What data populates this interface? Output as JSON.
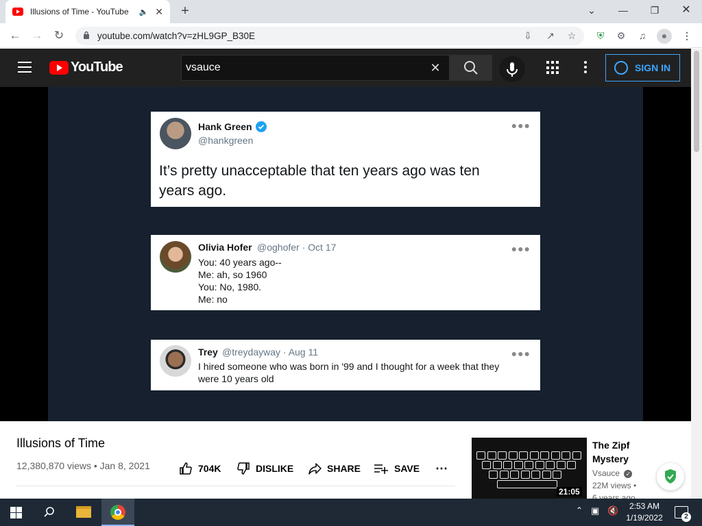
{
  "browser": {
    "tab_title": "Illusions of Time - YouTube",
    "url": "youtube.com/watch?v=zHL9GP_B30E"
  },
  "youtube": {
    "logo_text": "YouTube",
    "search_value": "vsauce",
    "sign_in_label": "SIGN IN"
  },
  "video_frame": {
    "tweets": [
      {
        "name": "Hank Green",
        "handle": "@hankgreen",
        "verified": true,
        "text_lines": [
          "It’s pretty unacceptable that ten years ago was ten",
          "years ago."
        ]
      },
      {
        "name": "Olivia Hofer",
        "handle": "@oghofer · Oct 17",
        "text_lines": [
          "You: 40 years ago--",
          "Me: ah, so 1960",
          "You: No, 1980.",
          "Me: no"
        ]
      },
      {
        "name": "Trey",
        "handle": "@treydayway · Aug 11",
        "text_lines": [
          "I hired someone who was born in '99 and I thought for a week that they",
          "were 10 years old"
        ]
      }
    ]
  },
  "video_info": {
    "title": "Illusions of Time",
    "views_date": "12,380,870 views • Jan 8, 2021",
    "actions": {
      "like": "704K",
      "dislike": "DISLIKE",
      "share": "SHARE",
      "save": "SAVE"
    }
  },
  "recommended": {
    "title_lines": [
      "The Zipf",
      "Mystery"
    ],
    "channel": "Vsauce",
    "views": "22M views •",
    "age": "6 years ago",
    "duration": "21:05"
  },
  "taskbar": {
    "time": "2:53 AM",
    "date": "1/19/2022",
    "notifications": "2"
  },
  "colors": {
    "yt_red": "#ff0000",
    "yt_dark": "#212121",
    "accent_blue": "#3ea6ff",
    "twitter_verified": "#1da1f2"
  }
}
